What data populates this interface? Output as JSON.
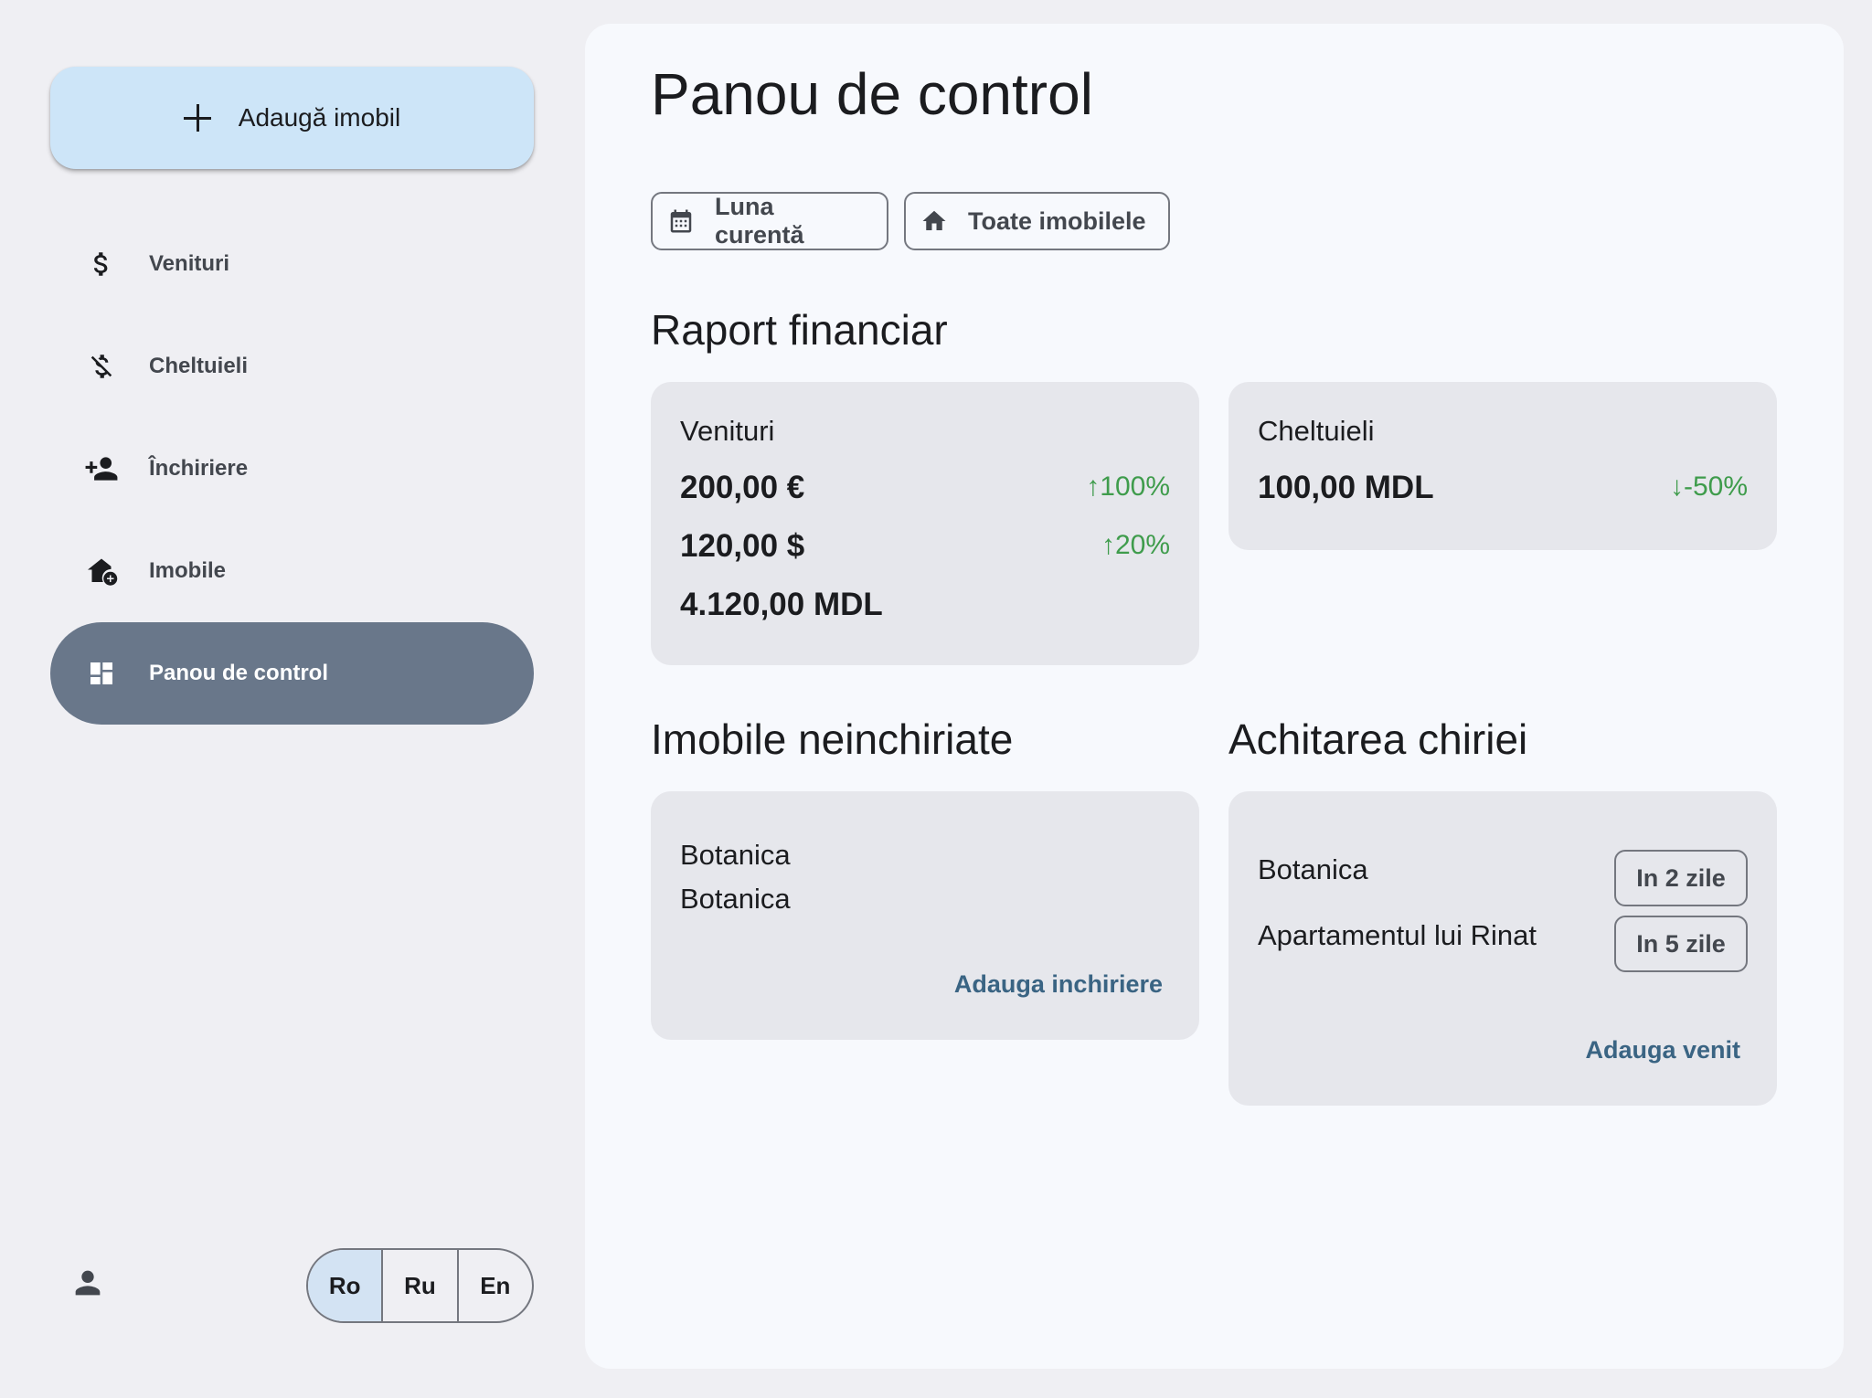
{
  "sidebar": {
    "add_button_label": "Adaugă imobil",
    "items": [
      {
        "label": "Venituri",
        "icon": "dollar-icon"
      },
      {
        "label": "Cheltuieli",
        "icon": "money-off-icon"
      },
      {
        "label": "Închiriere",
        "icon": "person-add-icon"
      },
      {
        "label": "Imobile",
        "icon": "house-add-icon"
      },
      {
        "label": "Panou de control",
        "icon": "dashboard-icon",
        "active": true
      }
    ],
    "languages": [
      "Ro",
      "Ru",
      "En"
    ],
    "selected_language": "Ro"
  },
  "main": {
    "title": "Panou de control",
    "filters": {
      "period": "Luna curentă",
      "property": "Toate imobilele"
    },
    "financial_report": {
      "title": "Raport financiar",
      "income": {
        "label": "Venituri",
        "rows": [
          {
            "amount": "200,00 €",
            "trend": "↑100%"
          },
          {
            "amount": "120,00 $",
            "trend": "↑20%"
          },
          {
            "amount": "4.120,00 MDL",
            "trend": ""
          }
        ]
      },
      "expenses": {
        "label": "Cheltuieli",
        "rows": [
          {
            "amount": "100,00 MDL",
            "trend": "↓-50%"
          }
        ]
      }
    },
    "unrented": {
      "title": "Imobile neinchiriate",
      "items": [
        "Botanica",
        "Botanica"
      ],
      "action": "Adauga inchiriere"
    },
    "rent_payment": {
      "title": "Achitarea chiriei",
      "items": [
        {
          "name": "Botanica",
          "due": "In 2 zile"
        },
        {
          "name": "Apartamentul lui Rinat",
          "due": "In 5 zile"
        }
      ],
      "action": "Adauga venit"
    }
  },
  "colors": {
    "accent": "#cde5f8",
    "nav_active": "#69778a",
    "trend_positive": "#3f9c4c",
    "link": "#3a6483"
  }
}
